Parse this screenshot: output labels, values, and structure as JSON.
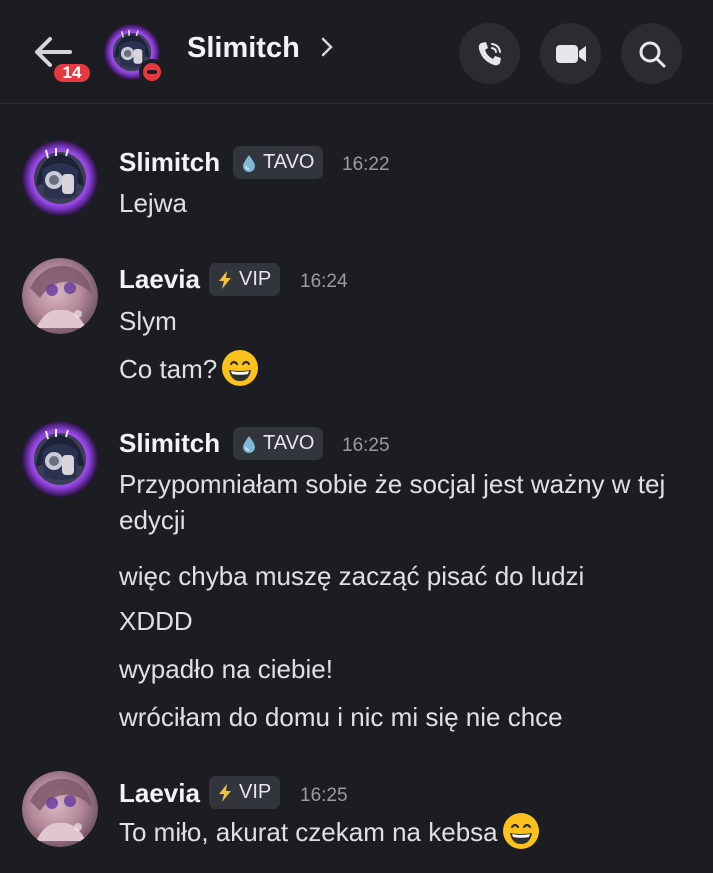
{
  "header": {
    "title": "Slimitch",
    "unread_count": "14",
    "icons": [
      "back-arrow-icon",
      "phone-call-icon",
      "video-camera-icon",
      "search-icon",
      "do-not-disturb-icon",
      "chevron-right-icon"
    ]
  },
  "colors": {
    "background": "#1c1d22",
    "badge_red": "#e5393f",
    "role_bg": "#33353c",
    "tavo_drop": "#7fb8d8",
    "vip_bolt": "#f0c33c"
  },
  "messages": [
    {
      "author": "Slimitch",
      "role": "TAVO",
      "role_icon": "water-drop-icon",
      "time": "16:22",
      "lines": [
        "Lejwa"
      ]
    },
    {
      "author": "Laevia",
      "role": "VIP",
      "role_icon": "lightning-icon",
      "time": "16:24",
      "lines": [
        "Slym",
        "Co tam?"
      ],
      "emoji": "grinning-face-emoji"
    },
    {
      "author": "Slimitch",
      "role": "TAVO",
      "role_icon": "water-drop-icon",
      "time": "16:25",
      "lines": [
        "Przypomniałam sobie że socjal jest ważny w tej edycji",
        "więc chyba muszę zacząć pisać do ludzi",
        "XDDD",
        "wypadło na ciebie!",
        "wróciłam do domu i nic mi się nie chce"
      ]
    },
    {
      "author": "Laevia",
      "role": "VIP",
      "role_icon": "lightning-icon",
      "time": "16:25",
      "lines": [
        "To miło, akurat czekam na kebsa"
      ],
      "emoji": "grinning-face-emoji"
    }
  ]
}
